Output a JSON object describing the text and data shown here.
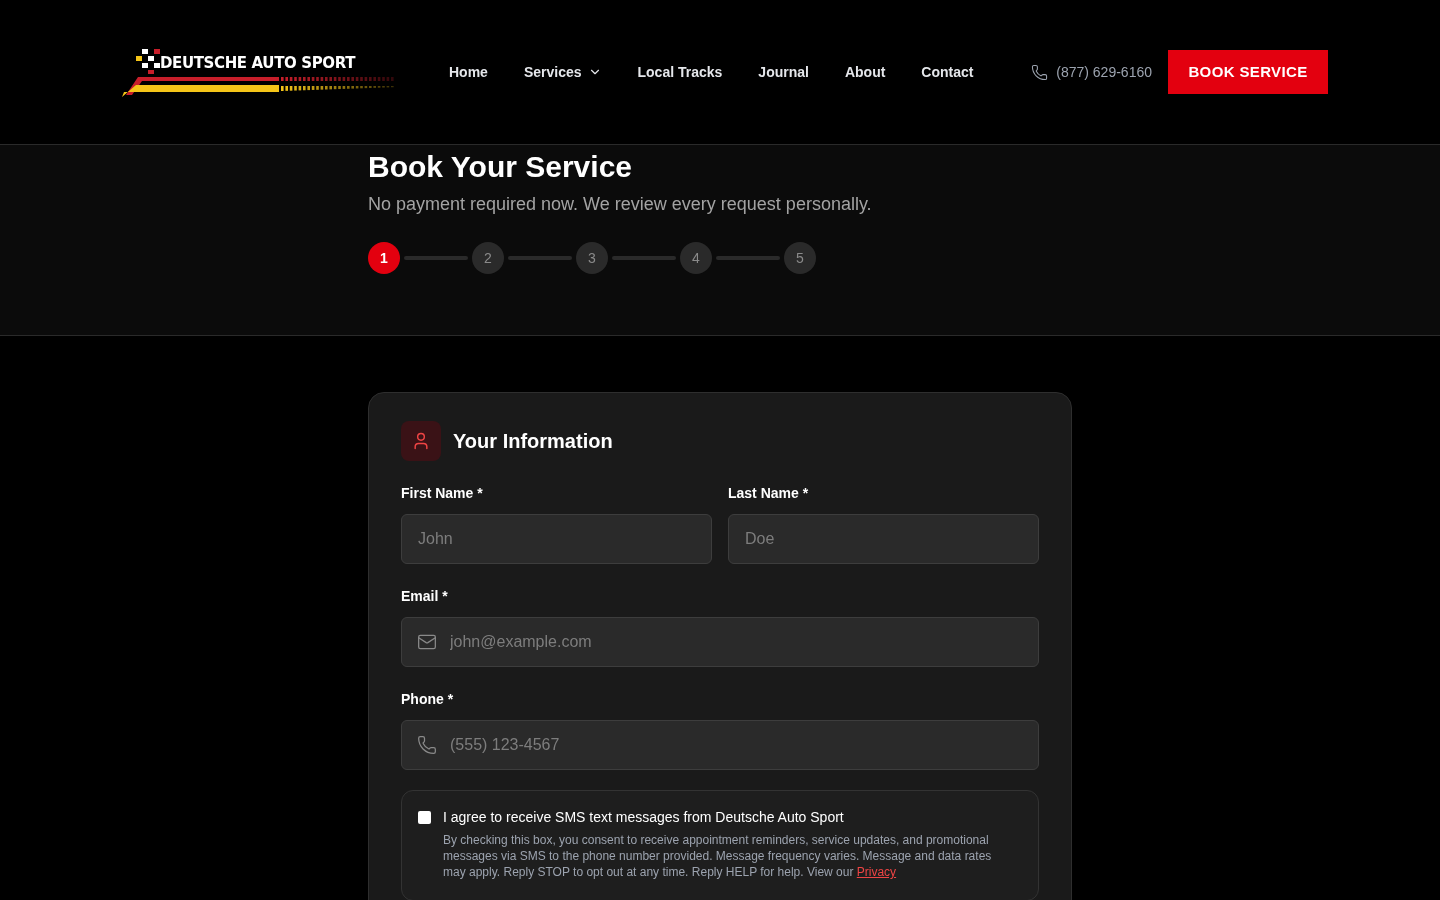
{
  "header": {
    "brand": "DEUTSCHE AUTO SPORT",
    "nav": [
      {
        "label": "Home",
        "dropdown": false
      },
      {
        "label": "Services",
        "dropdown": true
      },
      {
        "label": "Local Tracks",
        "dropdown": false
      },
      {
        "label": "Journal",
        "dropdown": false
      },
      {
        "label": "About",
        "dropdown": false
      },
      {
        "label": "Contact",
        "dropdown": false
      }
    ],
    "phone": "(877) 629-6160",
    "cta": "BOOK SERVICE"
  },
  "hero": {
    "title": "Book Your Service",
    "subtitle": "No payment required now. We review every request personally.",
    "steps": [
      {
        "label": "1",
        "selected": true
      },
      {
        "label": "2",
        "selected": false
      },
      {
        "label": "3",
        "selected": false
      },
      {
        "label": "4",
        "selected": false
      },
      {
        "label": "5",
        "selected": false
      }
    ]
  },
  "form": {
    "title": "Your Information",
    "fields": [
      {
        "label": "First Name *",
        "placeholder": "John",
        "kind": "text"
      },
      {
        "label": "Last Name *",
        "placeholder": "Doe",
        "kind": "text"
      },
      {
        "label": "Email *",
        "placeholder": "john@example.com",
        "kind": "email"
      },
      {
        "label": "Phone *",
        "placeholder": "(555) 123-4567",
        "kind": "phone"
      }
    ],
    "consent": {
      "checked": false,
      "label": "I agree to receive SMS text messages from Deutsche Auto Sport",
      "text": "By checking this box, you consent to receive appointment reminders, service updates, and promotional messages via SMS to the phone number provided. Message frequency varies. Message and data rates may apply. Reply STOP to opt out at any time. Reply HELP for help. View our",
      "link": "Privacy"
    }
  }
}
